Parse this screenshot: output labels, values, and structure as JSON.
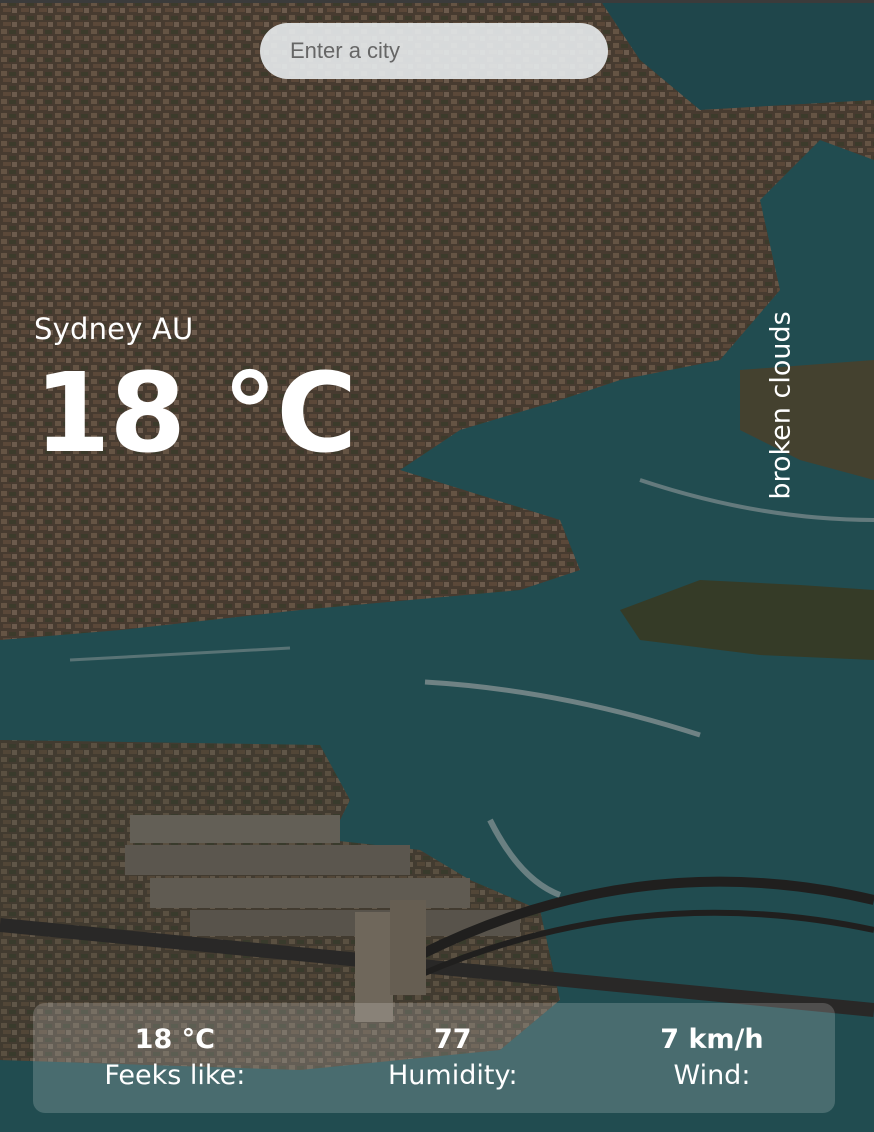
{
  "search": {
    "placeholder": "Enter a city"
  },
  "weather": {
    "city": "Sydney AU",
    "temperature": "18 °C",
    "description": "broken clouds"
  },
  "details": [
    {
      "value": "18 °C",
      "label": "Feeks like:"
    },
    {
      "value": "77",
      "label": "Humidity:"
    },
    {
      "value": "7 km/h",
      "label": "Wind:"
    }
  ],
  "colors": {
    "water": "#2f6e73",
    "land": "#6b5a4a",
    "text": "#ffffff"
  }
}
